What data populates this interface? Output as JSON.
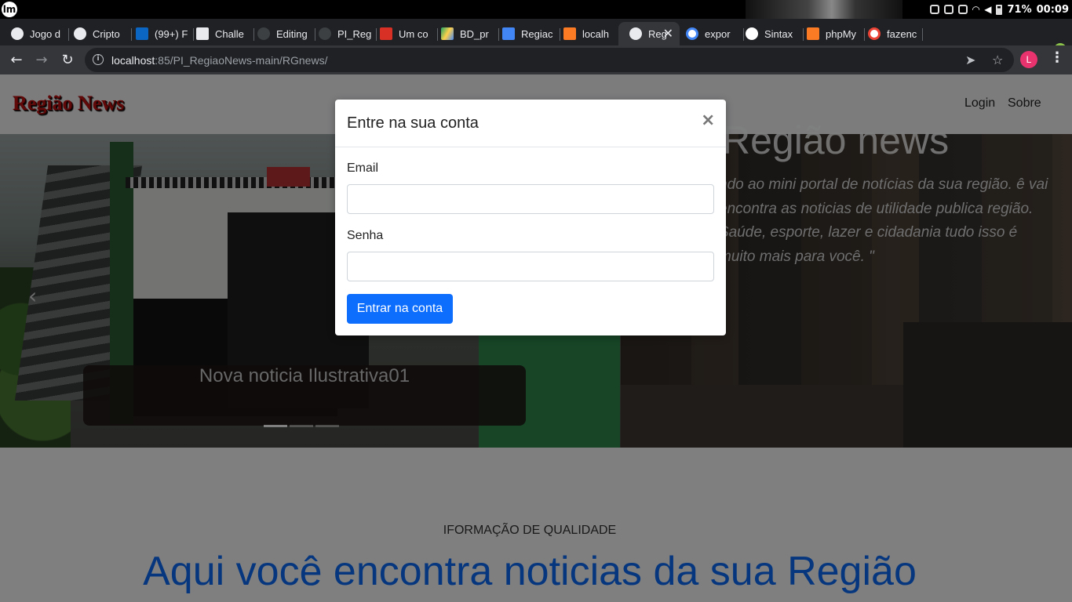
{
  "os": {
    "logo": "lm",
    "battery": "71%",
    "time": "00:09"
  },
  "browser": {
    "tabs": [
      {
        "label": "Jogo d",
        "icon": "globe-icon"
      },
      {
        "label": "Cripto",
        "icon": "globe-icon"
      },
      {
        "label": "(99+) F",
        "icon": "linkedin-icon"
      },
      {
        "label": "Challe",
        "icon": "trello-icon"
      },
      {
        "label": "Editing",
        "icon": "github-icon"
      },
      {
        "label": "PI_Reg",
        "icon": "github-icon"
      },
      {
        "label": "Um co",
        "icon": "gmail-icon"
      },
      {
        "label": "BD_pr",
        "icon": "drive-icon"
      },
      {
        "label": "Regiac",
        "icon": "docs-icon"
      },
      {
        "label": "localh",
        "icon": "xampp-icon"
      },
      {
        "label": "Reg",
        "icon": "globe-icon",
        "active": true
      },
      {
        "label": "expor",
        "icon": "google-icon"
      },
      {
        "label": "Sintax",
        "icon": "github-icon"
      },
      {
        "label": "phpMy",
        "icon": "xampp-icon"
      },
      {
        "label": "fazenc",
        "icon": "google-icon"
      }
    ],
    "url_host": "localhost",
    "url_rest": ":85/PI_RegiaoNews-main/RGnews/",
    "profile_initial": "L"
  },
  "site": {
    "brand": "Região News",
    "nav": {
      "login": "Login",
      "about": "Sobre"
    },
    "carousel_caption": "Nova noticia Ilustrativa01",
    "hero_title": "Região news",
    "hero_text": "ndo ao mini portal de notícias da sua região. ê vai encontra as noticias de utilidade publica região. Saúde, esporte, lazer e cidadania tudo isso é muito mais para você. \"",
    "eyebrow": "IFORMAÇÃO DE QUALIDADE",
    "headline": "Aqui você encontra noticias da sua Região"
  },
  "modal": {
    "title": "Entre na sua conta",
    "close": "×",
    "email_label": "Email",
    "email_value": "",
    "password_label": "Senha",
    "password_value": "",
    "submit": "Entrar na conta"
  },
  "colors": {
    "brand_red": "#c21010",
    "primary_blue": "#0d6efd",
    "profile_pink": "#e8336f"
  }
}
